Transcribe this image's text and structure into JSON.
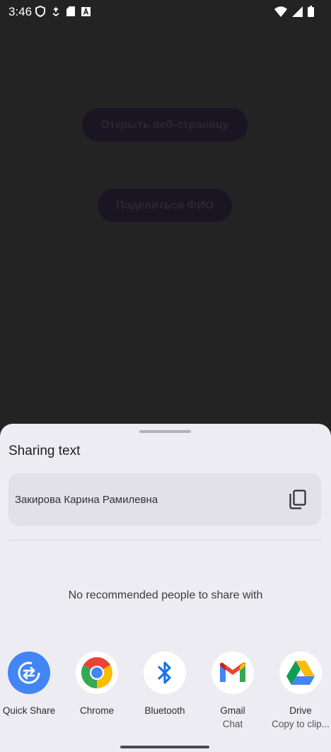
{
  "status_bar": {
    "time": "3:46",
    "left_icons": [
      "shield-icon",
      "data-saver-icon",
      "sd-card-icon",
      "keyboard-a-icon"
    ],
    "right_icons": [
      "wifi-icon",
      "signal-icon",
      "battery-icon"
    ]
  },
  "app": {
    "open_web_button": "Открыть веб-страницу",
    "share_name_button": "Поделиться ФИО"
  },
  "share_sheet": {
    "title": "Sharing text",
    "shared_text": "Закирова Карина Рамилевна",
    "no_people_message": "No recommended people to share with",
    "targets": [
      {
        "label": "Quick Share",
        "sublabel": "",
        "icon": "quick-share-icon"
      },
      {
        "label": "Chrome",
        "sublabel": "",
        "icon": "chrome-icon"
      },
      {
        "label": "Bluetooth",
        "sublabel": "",
        "icon": "bluetooth-icon"
      },
      {
        "label": "Gmail",
        "sublabel": "Chat",
        "icon": "gmail-icon"
      },
      {
        "label": "Drive",
        "sublabel": "Copy to clip...",
        "icon": "drive-icon"
      }
    ]
  },
  "colors": {
    "sheet_background": "#eeecf3",
    "scrim": "#232323",
    "quick_share_blue": "#4285f4"
  }
}
